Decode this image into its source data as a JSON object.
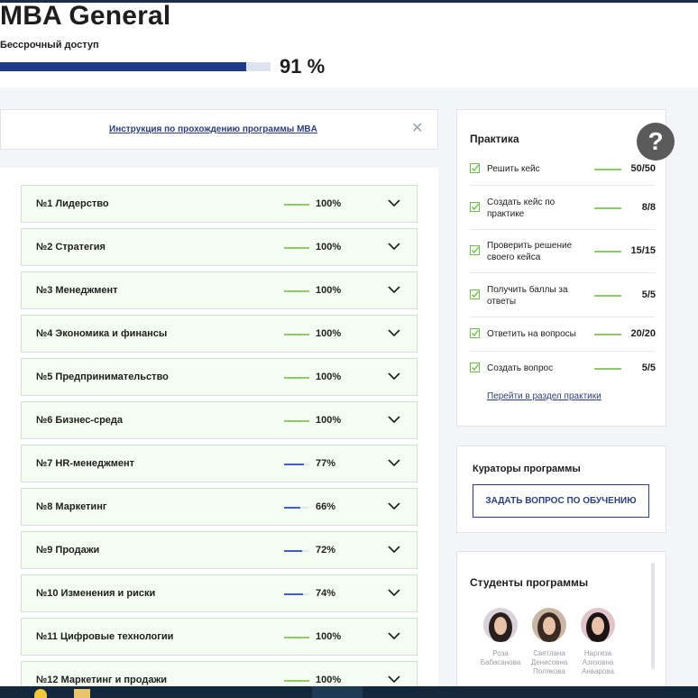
{
  "header": {
    "title": "MBA General",
    "access": "Бессрочный доступ",
    "progress": {
      "percent": 91,
      "label": "91 %"
    },
    "progress_color": "#1f3a8a"
  },
  "notice": {
    "link": "Инструкция по прохождению программы MBA",
    "close_icon": "close-icon",
    "close_glyph": "✕"
  },
  "modules": [
    {
      "name": "№1 Лидерство",
      "percent": 100,
      "label": "100%"
    },
    {
      "name": "№2 Стратегия",
      "percent": 100,
      "label": "100%"
    },
    {
      "name": "№3 Менеджмент",
      "percent": 100,
      "label": "100%"
    },
    {
      "name": "№4 Экономика и финансы",
      "percent": 100,
      "label": "100%"
    },
    {
      "name": "№5 Предпринимательство",
      "percent": 100,
      "label": "100%"
    },
    {
      "name": "№6 Бизнес-среда",
      "percent": 100,
      "label": "100%"
    },
    {
      "name": "№7 HR-менеджмент",
      "percent": 77,
      "label": "77%"
    },
    {
      "name": "№8 Маркетинг",
      "percent": 66,
      "label": "66%"
    },
    {
      "name": "№9 Продажи",
      "percent": 72,
      "label": "72%"
    },
    {
      "name": "№10 Изменения и риски",
      "percent": 74,
      "label": "74%"
    },
    {
      "name": "№11 Цифровые технологии",
      "percent": 100,
      "label": "100%"
    },
    {
      "name": "№12 Маркетинг и продажи",
      "percent": 100,
      "label": "100%"
    }
  ],
  "colors": {
    "complete": "#8fcb6b",
    "partial": "#3d62c4",
    "accent": "#2b3f7a",
    "check": "#6cbf4b"
  },
  "practice": {
    "title": "Практика",
    "help_glyph": "?",
    "tasks": [
      {
        "label": "Решить кейс",
        "value": "50/50"
      },
      {
        "label": "Создать кейс по практике",
        "value": "8/8"
      },
      {
        "label": "Проверить решение своего кейса",
        "value": "15/15"
      },
      {
        "label": "Получить баллы за ответы",
        "value": "5/5"
      },
      {
        "label": "Ответить на вопросы",
        "value": "20/20"
      },
      {
        "label": "Создать вопрос",
        "value": "5/5"
      }
    ],
    "link": "Перейти в раздел практики"
  },
  "curators": {
    "title": "Кураторы программы",
    "button": "ЗАДАТЬ ВОПРОС ПО ОБУЧЕНИЮ"
  },
  "students": {
    "title": "Студенты программы",
    "list": [
      {
        "first": "Роза",
        "last": "Бабасанова"
      },
      {
        "first": "Светлана",
        "last": "Денисовна Полякова"
      },
      {
        "first": "Наргиза",
        "last": "Азизовна Анварова"
      }
    ]
  }
}
